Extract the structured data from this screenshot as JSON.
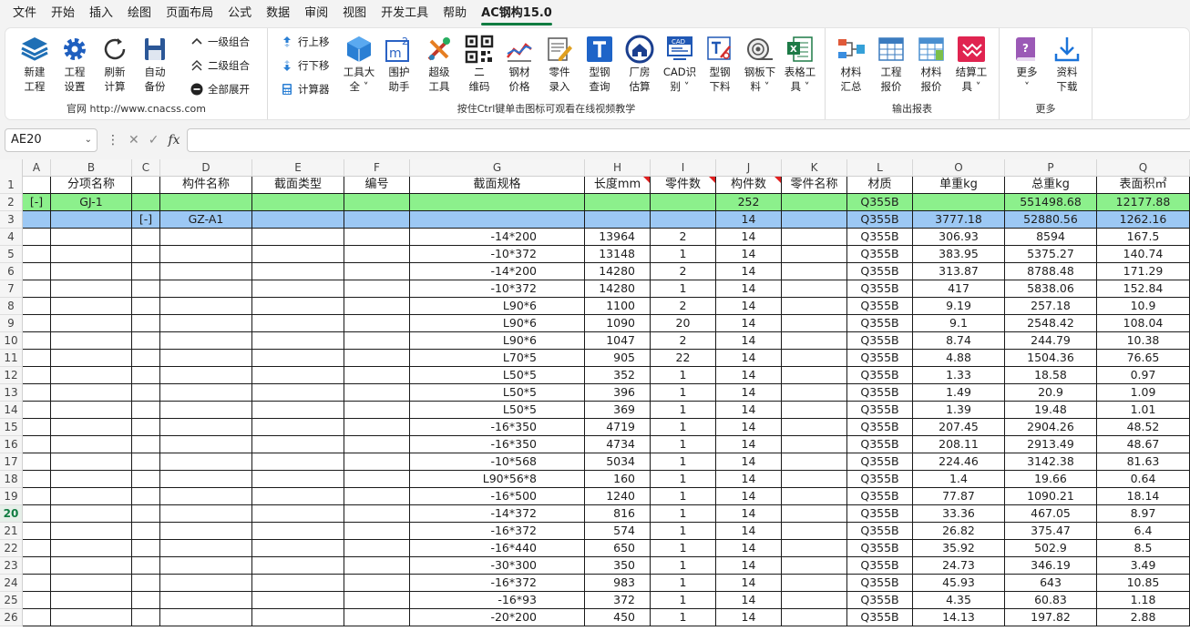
{
  "menu": [
    "文件",
    "开始",
    "插入",
    "绘图",
    "页面布局",
    "公式",
    "数据",
    "审阅",
    "视图",
    "开发工具",
    "帮助",
    "AC钢构15.0"
  ],
  "ribbon": {
    "group1": {
      "buttons": [
        {
          "label1": "新建",
          "label2": "工程",
          "icon": "layers-icon"
        },
        {
          "label1": "工程",
          "label2": "设置",
          "icon": "gear-icon"
        },
        {
          "label1": "刷新",
          "label2": "计算",
          "icon": "refresh-icon"
        },
        {
          "label1": "自动",
          "label2": "备份",
          "icon": "save-icon"
        }
      ],
      "small": [
        "一级组合",
        "二级组合",
        "全部展开"
      ],
      "label": "官网 http://www.cnacss.com"
    },
    "group2": {
      "small": [
        "行上移",
        "行下移",
        "计算器"
      ],
      "buttons": [
        {
          "label1": "工具大",
          "label2": "全 ˅",
          "icon": "cube-icon"
        },
        {
          "label1": "围护",
          "label2": "助手",
          "icon": "area-m2-icon"
        },
        {
          "label1": "超级",
          "label2": "工具",
          "icon": "tools-icon"
        },
        {
          "label1": "二",
          "label2": "维码",
          "icon": "qrcode-icon"
        },
        {
          "label1": "钢材",
          "label2": "价格",
          "icon": "chart-line-icon"
        },
        {
          "label1": "零件",
          "label2": "录入",
          "icon": "edit-form-icon"
        },
        {
          "label1": "型钢",
          "label2": "查询",
          "icon": "t-section-icon"
        },
        {
          "label1": "厂房",
          "label2": "估算",
          "icon": "house-icon"
        },
        {
          "label1": "CAD识",
          "label2": "别 ˅",
          "icon": "cad-icon"
        },
        {
          "label1": "型钢",
          "label2": "下料",
          "icon": "steel-cut-icon"
        },
        {
          "label1": "钢板下",
          "label2": "料 ˅",
          "icon": "coil-icon"
        },
        {
          "label1": "表格工",
          "label2": "具 ˅",
          "icon": "excel-icon"
        }
      ],
      "label": "按住Ctrl键单击图标可观看在线视频教学"
    },
    "group3": {
      "buttons": [
        {
          "label1": "材料",
          "label2": "汇总",
          "icon": "summary-icon"
        },
        {
          "label1": "工程",
          "label2": "报价",
          "icon": "table-icon"
        },
        {
          "label1": "材料",
          "label2": "报价",
          "icon": "table-report-icon"
        },
        {
          "label1": "结算工",
          "label2": "具 ˅",
          "icon": "settle-icon"
        }
      ],
      "label": "输出报表"
    },
    "group4": {
      "buttons": [
        {
          "label1": "更多",
          "label2": "˅",
          "icon": "book-icon"
        },
        {
          "label1": "资料",
          "label2": "下载",
          "icon": "download-icon"
        }
      ],
      "label": "更多"
    }
  },
  "namebox": "AE20",
  "columns": [
    "A",
    "B",
    "C",
    "D",
    "E",
    "F",
    "G",
    "H",
    "I",
    "J",
    "K",
    "L",
    "O",
    "P",
    "Q"
  ],
  "header_row": [
    "",
    "分项名称",
    "",
    "构件名称",
    "截面类型",
    "编号",
    "截面规格",
    "长度mm",
    "零件数",
    "构件数",
    "零件名称",
    "材质",
    "单重kg",
    "总重kg",
    "表面积㎡"
  ],
  "rows": [
    [
      "[-]",
      "GJ-1",
      "",
      "",
      "",
      "",
      "",
      "",
      "",
      "252",
      "",
      "Q355B",
      "",
      "551498.68",
      "12177.88"
    ],
    [
      "",
      "",
      "[-]",
      "GZ-A1",
      "",
      "",
      "",
      "",
      "",
      "14",
      "",
      "Q355B",
      "3777.18",
      "52880.56",
      "1262.16"
    ],
    [
      "",
      "",
      "",
      "",
      "",
      "",
      "-14*200",
      "13964",
      "2",
      "14",
      "",
      "Q355B",
      "306.93",
      "8594",
      "167.5"
    ],
    [
      "",
      "",
      "",
      "",
      "",
      "",
      "-10*372",
      "13148",
      "1",
      "14",
      "",
      "Q355B",
      "383.95",
      "5375.27",
      "140.74"
    ],
    [
      "",
      "",
      "",
      "",
      "",
      "",
      "-14*200",
      "14280",
      "2",
      "14",
      "",
      "Q355B",
      "313.87",
      "8788.48",
      "171.29"
    ],
    [
      "",
      "",
      "",
      "",
      "",
      "",
      "-10*372",
      "14280",
      "1",
      "14",
      "",
      "Q355B",
      "417",
      "5838.06",
      "152.84"
    ],
    [
      "",
      "",
      "",
      "",
      "",
      "",
      "L90*6",
      "1100",
      "2",
      "14",
      "",
      "Q355B",
      "9.19",
      "257.18",
      "10.9"
    ],
    [
      "",
      "",
      "",
      "",
      "",
      "",
      "L90*6",
      "1090",
      "20",
      "14",
      "",
      "Q355B",
      "9.1",
      "2548.42",
      "108.04"
    ],
    [
      "",
      "",
      "",
      "",
      "",
      "",
      "L90*6",
      "1047",
      "2",
      "14",
      "",
      "Q355B",
      "8.74",
      "244.79",
      "10.38"
    ],
    [
      "",
      "",
      "",
      "",
      "",
      "",
      "L70*5",
      "905",
      "22",
      "14",
      "",
      "Q355B",
      "4.88",
      "1504.36",
      "76.65"
    ],
    [
      "",
      "",
      "",
      "",
      "",
      "",
      "L50*5",
      "352",
      "1",
      "14",
      "",
      "Q355B",
      "1.33",
      "18.58",
      "0.97"
    ],
    [
      "",
      "",
      "",
      "",
      "",
      "",
      "L50*5",
      "396",
      "1",
      "14",
      "",
      "Q355B",
      "1.49",
      "20.9",
      "1.09"
    ],
    [
      "",
      "",
      "",
      "",
      "",
      "",
      "L50*5",
      "369",
      "1",
      "14",
      "",
      "Q355B",
      "1.39",
      "19.48",
      "1.01"
    ],
    [
      "",
      "",
      "",
      "",
      "",
      "",
      "-16*350",
      "4719",
      "1",
      "14",
      "",
      "Q355B",
      "207.45",
      "2904.26",
      "48.52"
    ],
    [
      "",
      "",
      "",
      "",
      "",
      "",
      "-16*350",
      "4734",
      "1",
      "14",
      "",
      "Q355B",
      "208.11",
      "2913.49",
      "48.67"
    ],
    [
      "",
      "",
      "",
      "",
      "",
      "",
      "-10*568",
      "5034",
      "1",
      "14",
      "",
      "Q355B",
      "224.46",
      "3142.38",
      "81.63"
    ],
    [
      "",
      "",
      "",
      "",
      "",
      "",
      "L90*56*8",
      "160",
      "1",
      "14",
      "",
      "Q355B",
      "1.4",
      "19.66",
      "0.64"
    ],
    [
      "",
      "",
      "",
      "",
      "",
      "",
      "-16*500",
      "1240",
      "1",
      "14",
      "",
      "Q355B",
      "77.87",
      "1090.21",
      "18.14"
    ],
    [
      "",
      "",
      "",
      "",
      "",
      "",
      "-14*372",
      "816",
      "1",
      "14",
      "",
      "Q355B",
      "33.36",
      "467.05",
      "8.97"
    ],
    [
      "",
      "",
      "",
      "",
      "",
      "",
      "-16*372",
      "574",
      "1",
      "14",
      "",
      "Q355B",
      "26.82",
      "375.47",
      "6.4"
    ],
    [
      "",
      "",
      "",
      "",
      "",
      "",
      "-16*440",
      "650",
      "1",
      "14",
      "",
      "Q355B",
      "35.92",
      "502.9",
      "8.5"
    ],
    [
      "",
      "",
      "",
      "",
      "",
      "",
      "-30*300",
      "350",
      "1",
      "14",
      "",
      "Q355B",
      "24.73",
      "346.19",
      "3.49"
    ],
    [
      "",
      "",
      "",
      "",
      "",
      "",
      "-16*372",
      "983",
      "1",
      "14",
      "",
      "Q355B",
      "45.93",
      "643",
      "10.85"
    ],
    [
      "",
      "",
      "",
      "",
      "",
      "",
      "-16*93",
      "372",
      "1",
      "14",
      "",
      "Q355B",
      "4.35",
      "60.83",
      "1.18"
    ],
    [
      "",
      "",
      "",
      "",
      "",
      "",
      "-20*200",
      "450",
      "1",
      "14",
      "",
      "Q355B",
      "14.13",
      "197.82",
      "2.88"
    ]
  ],
  "selected_row": 20
}
